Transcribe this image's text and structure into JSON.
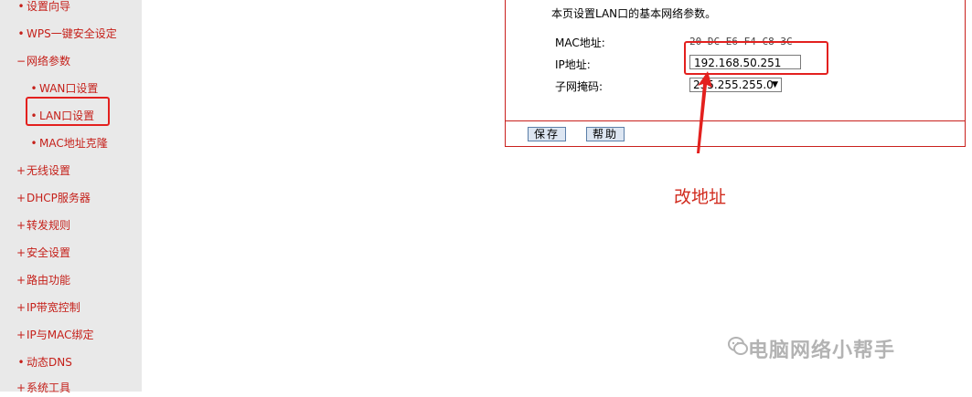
{
  "sidebar": {
    "items": [
      {
        "mark": "•",
        "label": "设置向导"
      },
      {
        "mark": "•",
        "label": "WPS一键安全设定"
      },
      {
        "mark": "−",
        "label": "网络参数"
      },
      {
        "mark": "•",
        "label": "WAN口设置"
      },
      {
        "mark": "•",
        "label": "LAN口设置"
      },
      {
        "mark": "•",
        "label": "MAC地址克隆"
      },
      {
        "mark": "+",
        "label": "无线设置"
      },
      {
        "mark": "+",
        "label": "DHCP服务器"
      },
      {
        "mark": "+",
        "label": "转发规则"
      },
      {
        "mark": "+",
        "label": "安全设置"
      },
      {
        "mark": "+",
        "label": "路由功能"
      },
      {
        "mark": "+",
        "label": "IP带宽控制"
      },
      {
        "mark": "+",
        "label": "IP与MAC绑定"
      },
      {
        "mark": "•",
        "label": "动态DNS"
      },
      {
        "mark": "+",
        "label": "系统工具"
      }
    ]
  },
  "panel": {
    "description": "本页设置LAN口的基本网络参数。",
    "mac_label": "MAC地址:",
    "mac_value": "20-DC-E6-F4-C8-3C",
    "ip_label": "IP地址:",
    "ip_value": "192.168.50.251",
    "mask_label": "子网掩码:",
    "mask_value": "255.255.255.0",
    "save_button": "保存",
    "help_button": "帮助"
  },
  "annotation": "改地址",
  "watermark": "电脑网络小帮手",
  "colors": {
    "accent_red": "#e3201e",
    "sidebar_bg": "#e9e9e9",
    "nav_text": "#c5201a"
  }
}
